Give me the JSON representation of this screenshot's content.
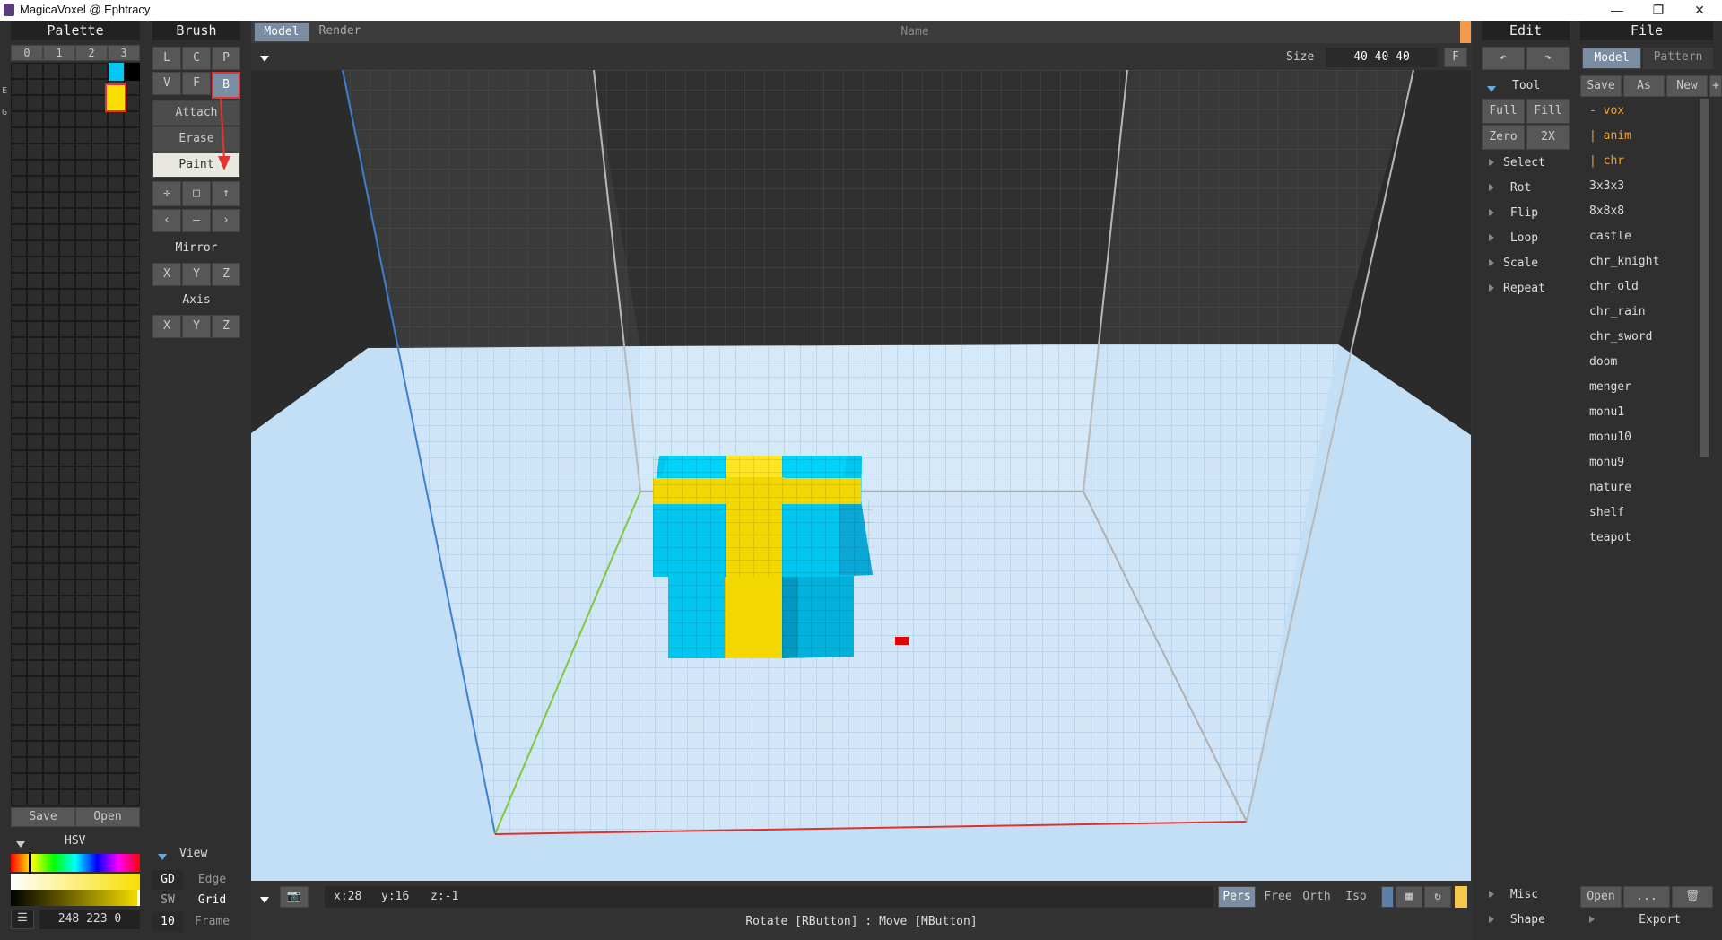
{
  "window": {
    "title": "MagicaVoxel @ Ephtracy"
  },
  "palette": {
    "header": "Palette",
    "tabs": [
      "0",
      "1",
      "2",
      "3"
    ],
    "side_letters": [
      "E",
      "G"
    ],
    "save": "Save",
    "open": "Open",
    "hsv_label": "HSV",
    "color_value": "248 223 0",
    "selected_color": "#f8df00",
    "accent_color": "#00c8f0"
  },
  "brush": {
    "header": "Brush",
    "row1": [
      "L",
      "C",
      "P"
    ],
    "row2": [
      "V",
      "F",
      "B"
    ],
    "modes": [
      "Attach",
      "Erase",
      "Paint"
    ],
    "mirror_label": "Mirror",
    "mirror_axes": [
      "X",
      "Y",
      "Z"
    ],
    "axis_label": "Axis",
    "axis_axes": [
      "X",
      "Y",
      "Z"
    ]
  },
  "view": {
    "label": "View",
    "rows": [
      {
        "key": "GD",
        "val": "Edge"
      },
      {
        "key": "SW",
        "val": "Grid"
      },
      {
        "key": "10",
        "val": "Frame"
      }
    ]
  },
  "viewport": {
    "tabs": [
      "Model",
      "Render"
    ],
    "name_placeholder": "Name",
    "size_label": "Size",
    "size_value": "40 40 40",
    "f_button": "F",
    "coords": {
      "x": "x:28",
      "y": "y:16",
      "z": "z:-1"
    },
    "cameras": [
      "Pers",
      "Free",
      "Orth",
      "Iso"
    ],
    "status": "Rotate [RButton] : Move [MButton]"
  },
  "edit": {
    "header": "Edit",
    "tool_label": "Tool",
    "tool_buttons": [
      "Full",
      "Fill",
      "Zero",
      "2X"
    ],
    "items": [
      "Select",
      "Rot",
      "Flip",
      "Loop",
      "Scale",
      "Repeat"
    ],
    "misc": "Misc",
    "shape": "Shape"
  },
  "file": {
    "header": "File",
    "tabs": [
      "Model",
      "Pattern"
    ],
    "actions": [
      "Save",
      "As",
      "New",
      "+"
    ],
    "folders": [
      "- vox",
      "| anim",
      "| chr"
    ],
    "files": [
      "3x3x3",
      "8x8x8",
      "castle",
      "chr_knight",
      "chr_old",
      "chr_rain",
      "chr_sword",
      "doom",
      "menger",
      "monu1",
      "monu10",
      "monu9",
      "nature",
      "shelf",
      "teapot"
    ],
    "open": "Open",
    "more": "...",
    "export": "Export"
  }
}
